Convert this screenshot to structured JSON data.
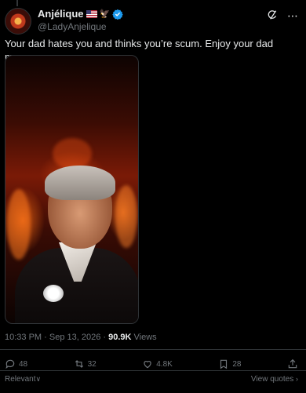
{
  "tweet": {
    "author_name": "Anjélique",
    "handle": "@LadyAnjelique",
    "text": "Your dad hates you and thinks you’re scum. Enjoy your dad meme",
    "timestamp": "10:33 PM · Sep 13, 2026 · ",
    "views_count": "90.9K",
    "views_label": " Views"
  },
  "actions": {
    "replies": "48",
    "reposts": "32",
    "likes": "4.8K",
    "bookmarks": "28"
  },
  "footer": {
    "sort_label": "Relevant",
    "view_quotes_label": "View quotes"
  },
  "icons": [
    "grok-icon",
    "more-icon",
    "reply-icon",
    "repost-icon",
    "like-icon",
    "bookmark-icon",
    "share-icon"
  ],
  "colors": {
    "verified": "#1d9bf0",
    "text": "#e7e9ea",
    "muted": "#71767b"
  }
}
